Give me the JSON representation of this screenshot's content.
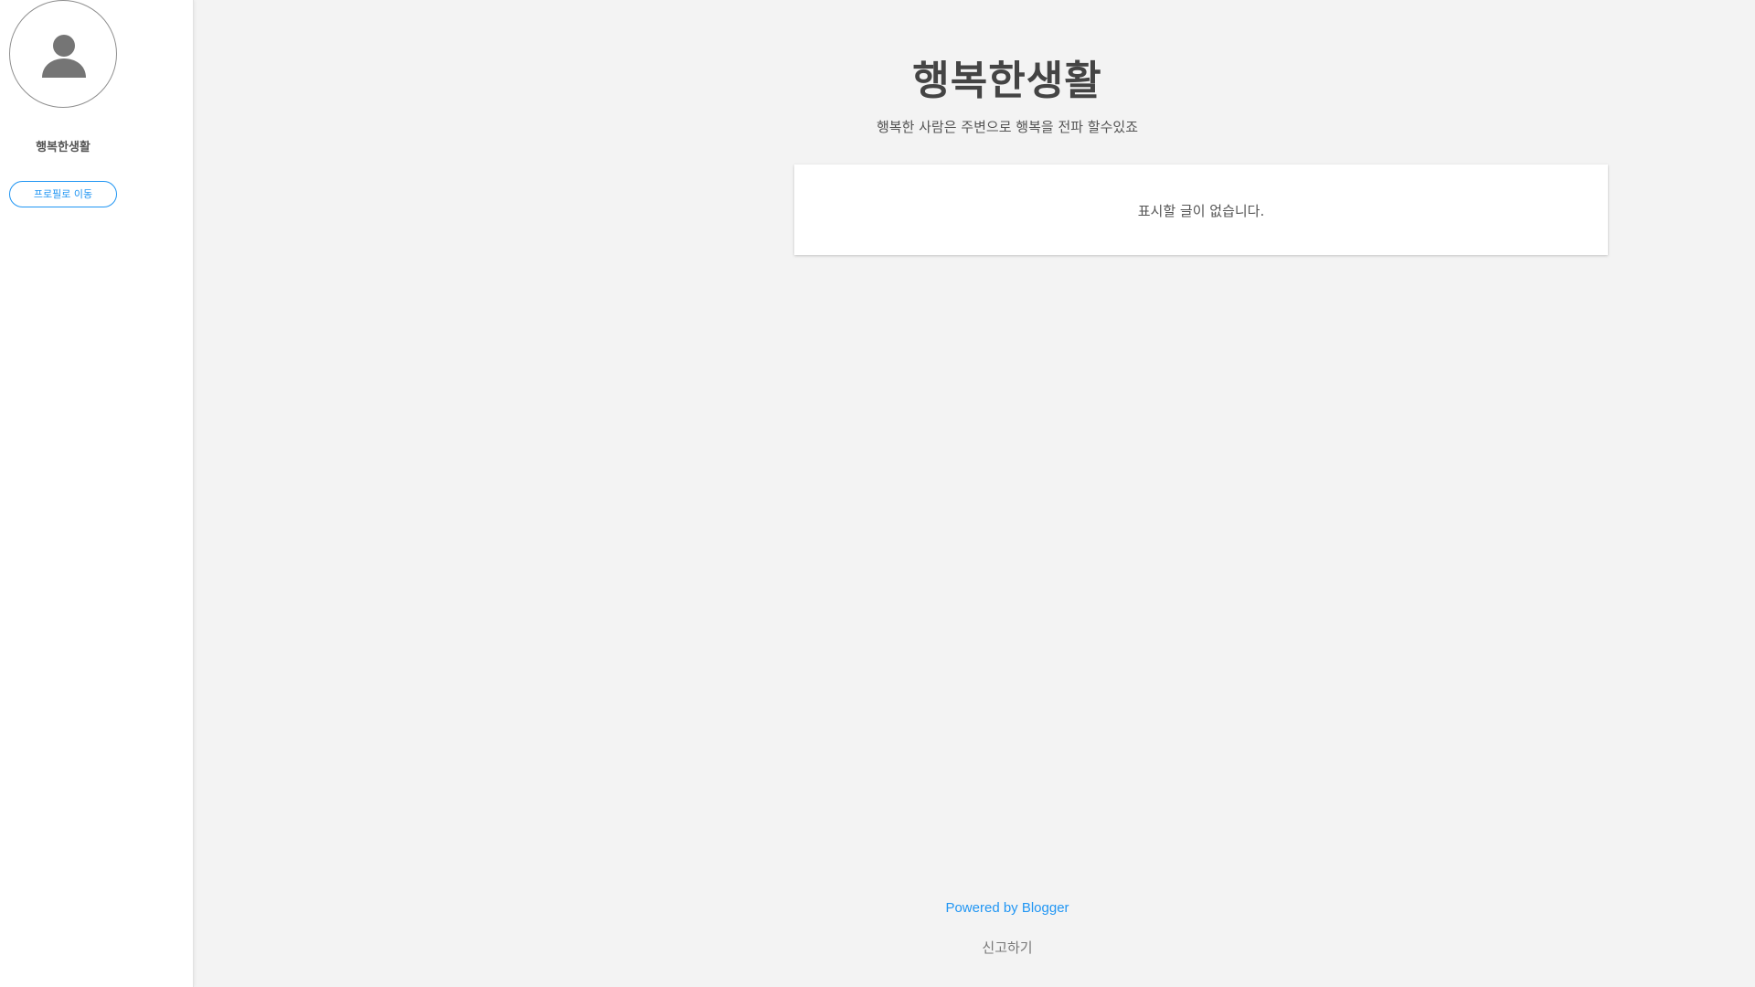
{
  "sidebar": {
    "avatar_icon": "person-icon",
    "profile_name": "행복한생활",
    "profile_button_label": "프로필로 이동"
  },
  "header": {
    "title": "행복한생활",
    "description": "행복한 사람은 주변으로 행복을 전파 할수있죠"
  },
  "main": {
    "empty_message": "표시할 글이 없습니다."
  },
  "footer": {
    "powered_by": "Powered by Blogger",
    "report": "신고하기"
  },
  "colors": {
    "accent": "#2196f3",
    "background": "#f3f3f3",
    "text": "#444444"
  }
}
